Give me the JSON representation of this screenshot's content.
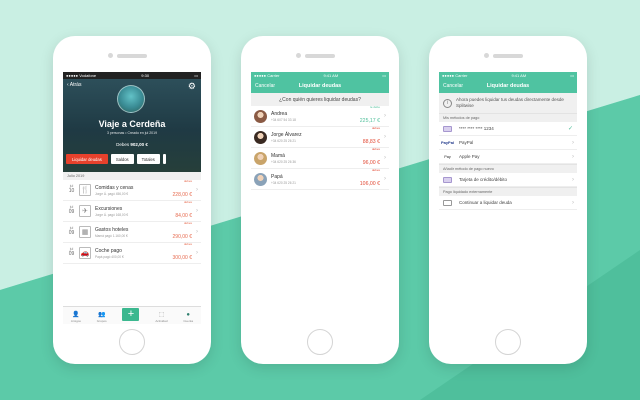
{
  "colors": {
    "accent": "#4fc3a1",
    "owe": "#e24a35",
    "owed": "#4fbf9a"
  },
  "phone1": {
    "status": {
      "carrier": "●●●●● Vodafone",
      "time": "9:30",
      "battery": "▭"
    },
    "back_label": "Atrás",
    "settings_icon": "gear-icon",
    "trip_title": "Viaje a Cerdeña",
    "trip_sub": "3 personas • Creado en jul 2019",
    "owe_label": "Debes",
    "owe_amount": "902,00 €",
    "buttons": {
      "settle": "Liquidar deudas",
      "balances": "Saldos",
      "totals": "Totales"
    },
    "section": "Julio 2019",
    "expenses": [
      {
        "month": "jul",
        "day": "10",
        "icon": "🍴",
        "name": "Comidas y cenas",
        "meta": "Jorge Á. pagó 456,00 €",
        "label": "debes",
        "amount": "228,00 €"
      },
      {
        "month": "jul",
        "day": "09",
        "icon": "✈",
        "name": "Excursiones",
        "meta": "Jorge Á. pagó 168,00 €",
        "label": "debes",
        "amount": "84,00 €"
      },
      {
        "month": "jul",
        "day": "09",
        "icon": "▦",
        "name": "Gastos hoteles",
        "meta": "Mamá pagó 1.160,00 €",
        "label": "debes",
        "amount": "290,00 €"
      },
      {
        "month": "jul",
        "day": "09",
        "icon": "🚗",
        "name": "Coche pago",
        "meta": "Papá pagó 400,00 €",
        "label": "debes",
        "amount": "300,00 €"
      }
    ],
    "tabs": {
      "friends": "Amigos",
      "groups": "Grupos",
      "activity": "Actividad",
      "account": "Cuenta"
    }
  },
  "phone2": {
    "status": {
      "carrier": "●●●●● Carrier",
      "time": "9:41 AM",
      "battery": "▭"
    },
    "cancel": "Cancelar",
    "title": "Liquidar deudas",
    "question": "¿Con quién quieres liquidar deudas?",
    "people": [
      {
        "name": "Andrea",
        "phone": "+34 607 54 33 18",
        "label": "te debe",
        "amount": "225,17 €",
        "kind": "owed",
        "color": "#8a5a44"
      },
      {
        "name": "Jorge Álvarez",
        "phone": "+34 620 25 26 21",
        "label": "debes",
        "amount": "88,83 €",
        "kind": "owe",
        "color": "#3a2a22"
      },
      {
        "name": "Mamá",
        "phone": "+34 620 25 26 36",
        "label": "debes",
        "amount": "96,00 €",
        "kind": "owe",
        "color": "#c9a46a"
      },
      {
        "name": "Papá",
        "phone": "+34 620 25 26 21",
        "label": "debes",
        "amount": "106,00 €",
        "kind": "owe",
        "color": "#8aa2b8"
      }
    ]
  },
  "phone3": {
    "status": {
      "carrier": "●●●●● Carrier",
      "time": "9:41 AM",
      "battery": "▭"
    },
    "cancel": "Cancelar",
    "title": "Liquidar deudas",
    "info": "Ahora puedes liquidar tus deudas directamente desde Splitwise",
    "section_methods": "Mis métodos de pago",
    "card_number": "**** **** **** 1234",
    "paypal": "PayPal",
    "paypal_icon": "PayPal",
    "applepay": "Apple Pay",
    "applepay_icon": "Pay",
    "section_add": "Añadir método de pago nuevo",
    "add_card": "Tarjeta de crédito/débito",
    "section_external": "Pago liquidado externamente",
    "continue": "Continuar a liquidar deuda"
  }
}
